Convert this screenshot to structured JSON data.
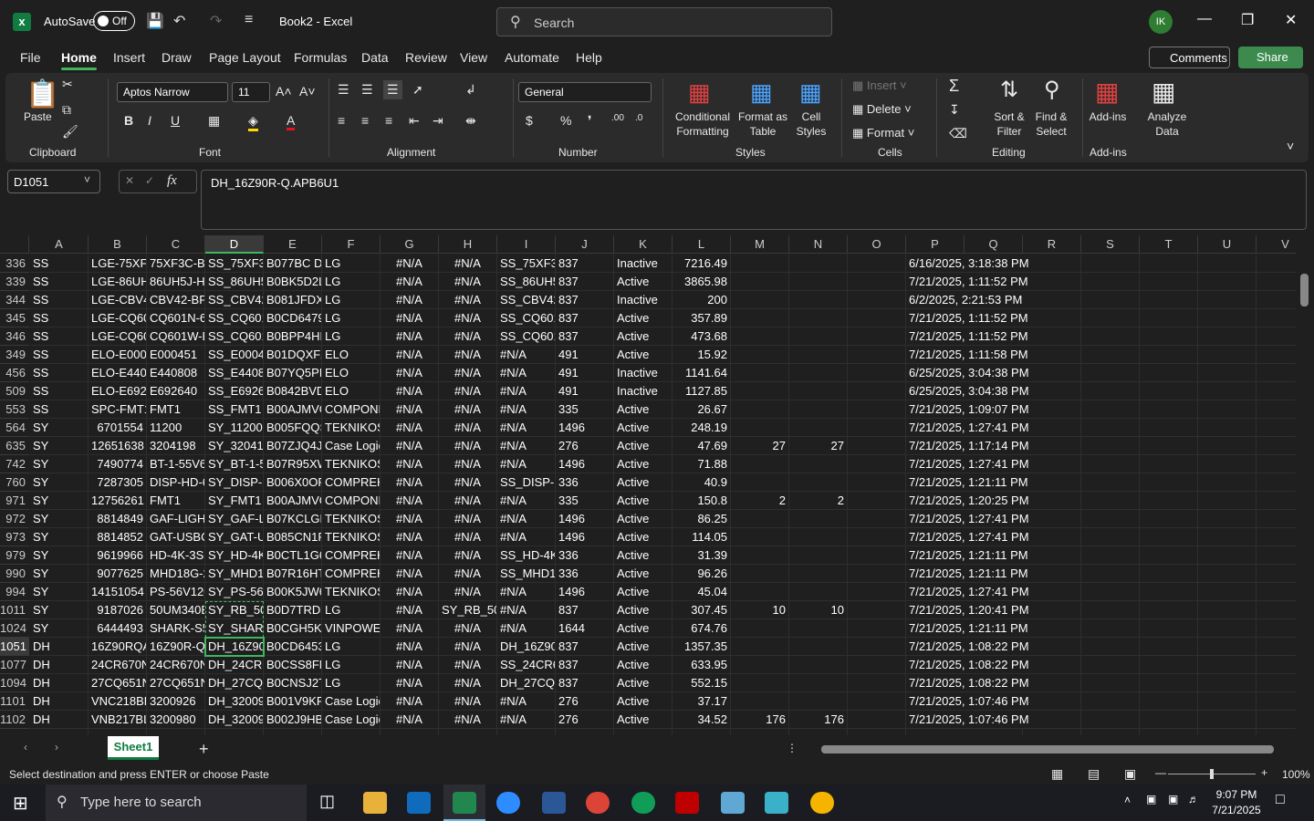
{
  "titlebar": {
    "autosave_label": "AutoSave",
    "autosave_state": "Off",
    "doc_title": "Book2  -  Excel",
    "search_placeholder": "Search",
    "avatar_initials": "IK"
  },
  "menu": {
    "tabs": [
      "File",
      "Home",
      "Insert",
      "Draw",
      "Page Layout",
      "Formulas",
      "Data",
      "Review",
      "View",
      "Automate",
      "Help"
    ],
    "active": "Home",
    "comments_label": "Comments",
    "share_label": "Share"
  },
  "ribbon": {
    "clipboard": {
      "paste": "Paste",
      "group": "Clipboard"
    },
    "font": {
      "name": "Aptos Narrow",
      "size": "11",
      "group": "Font"
    },
    "alignment": {
      "group": "Alignment"
    },
    "number": {
      "format": "General",
      "group": "Number"
    },
    "styles": {
      "conditional": [
        "Conditional",
        "Formatting"
      ],
      "format_table": [
        "Format as",
        "Table"
      ],
      "cell_styles": [
        "Cell",
        "Styles"
      ],
      "group": "Styles"
    },
    "cells": {
      "insert": "Insert",
      "delete": "Delete",
      "format": "Format",
      "group": "Cells"
    },
    "editing": {
      "sort": [
        "Sort &",
        "Filter"
      ],
      "find": [
        "Find &",
        "Select"
      ],
      "group": "Editing"
    },
    "addins": {
      "addins": "Add-ins",
      "analyze": [
        "Analyze",
        "Data"
      ],
      "group": "Add-ins"
    }
  },
  "formula_bar": {
    "name_box": "D1051",
    "formula": "DH_16Z90R-Q.APB6U1"
  },
  "grid": {
    "columns": [
      "A",
      "B",
      "C",
      "D",
      "E",
      "F",
      "G",
      "H",
      "I",
      "J",
      "K",
      "L",
      "M",
      "N",
      "O",
      "P",
      "Q",
      "R",
      "S",
      "T",
      "U",
      "V"
    ],
    "selected_column": "D",
    "selected_row": "1051",
    "rows": [
      {
        "r": "336",
        "A": "SS",
        "B": "LGE-75XF3",
        "C": "75XF3C-B",
        "D": "SS_75XF3C",
        "E": "B077BC DG",
        "F": "LG",
        "G": "#N/A",
        "H": "#N/A",
        "I": "SS_75XF3C",
        "J": "837",
        "K": "Inactive",
        "L": "7216.49",
        "M": "",
        "N": "",
        "P": "6/16/2025, 3:18:38 PM"
      },
      {
        "r": "339",
        "A": "SS",
        "B": "LGE-86UH5",
        "C": "86UH5J-H",
        "D": "SS_86UH5.",
        "E": "B0BK5D2L",
        "F": "LG",
        "G": "#N/A",
        "H": "#N/A",
        "I": "SS_86UH5.",
        "J": "837",
        "K": "Active",
        "L": "3865.98",
        "M": "",
        "N": "",
        "P": "7/21/2025, 1:11:52 PM"
      },
      {
        "r": "344",
        "A": "SS",
        "B": "LGE-CBV42",
        "C": "CBV42-BP",
        "D": "SS_CBV42-",
        "E": "B081JFDX",
        "F": "LG",
        "G": "#N/A",
        "H": "#N/A",
        "I": "SS_CBV42-",
        "J": "837",
        "K": "Inactive",
        "L": "200",
        "M": "",
        "N": "",
        "P": "6/2/2025, 2:21:53 PM"
      },
      {
        "r": "345",
        "A": "SS",
        "B": "LGE-CQ60",
        "C": "CQ601N-6",
        "D": "SS_CQ601",
        "E": "B0CD6479",
        "F": "LG",
        "G": "#N/A",
        "H": "#N/A",
        "I": "SS_CQ601",
        "J": "837",
        "K": "Active",
        "L": "357.89",
        "M": "",
        "N": "",
        "P": "7/21/2025, 1:11:52 PM"
      },
      {
        "r": "346",
        "A": "SS",
        "B": "LGE-CQ60",
        "C": "CQ601W-E",
        "D": "SS_CQ601",
        "E": "B0BPP4HL",
        "F": "LG",
        "G": "#N/A",
        "H": "#N/A",
        "I": "SS_CQ601",
        "J": "837",
        "K": "Active",
        "L": "473.68",
        "M": "",
        "N": "",
        "P": "7/21/2025, 1:11:52 PM"
      },
      {
        "r": "349",
        "A": "SS",
        "B": "ELO-E0004",
        "C": "E000451",
        "D": "SS_E00045",
        "E": "B01DQXFZ",
        "F": "ELO",
        "G": "#N/A",
        "H": "#N/A",
        "I": "#N/A",
        "J": "491",
        "K": "Active",
        "L": "15.92",
        "M": "",
        "N": "",
        "P": "7/21/2025, 1:11:58 PM"
      },
      {
        "r": "456",
        "A": "SS",
        "B": "ELO-E4408",
        "C": "E440808",
        "D": "SS_E44080",
        "E": "B07YQ5PR",
        "F": "ELO",
        "G": "#N/A",
        "H": "#N/A",
        "I": "#N/A",
        "J": "491",
        "K": "Inactive",
        "L": "1141.64",
        "M": "",
        "N": "",
        "P": "6/25/2025, 3:04:38 PM"
      },
      {
        "r": "509",
        "A": "SS",
        "B": "ELO-E6926",
        "C": "E692640",
        "D": "SS_E69264",
        "E": "B0842BVD",
        "F": "ELO",
        "G": "#N/A",
        "H": "#N/A",
        "I": "#N/A",
        "J": "491",
        "K": "Inactive",
        "L": "1127.85",
        "M": "",
        "N": "",
        "P": "6/25/2025, 3:04:38 PM"
      },
      {
        "r": "553",
        "A": "SS",
        "B": "SPC-FMT1",
        "C": "FMT1",
        "D": "SS_FMT1",
        "E": "B00AJMVG",
        "F": "COMPONE",
        "G": "#N/A",
        "H": "#N/A",
        "I": "#N/A",
        "J": "335",
        "K": "Active",
        "L": "26.67",
        "M": "",
        "N": "",
        "P": "7/21/2025, 1:09:07 PM"
      },
      {
        "r": "564",
        "A": "SY",
        "B": "6701554",
        "C": "11200",
        "D": "SY_11200",
        "E": "B005FQQS",
        "F": "TEKNIKOS",
        "G": "#N/A",
        "H": "#N/A",
        "I": "#N/A",
        "J": "1496",
        "K": "Active",
        "L": "248.19",
        "M": "",
        "N": "",
        "P": "7/21/2025, 1:27:41 PM"
      },
      {
        "r": "635",
        "A": "SY",
        "B": "12651638",
        "C": "3204198",
        "D": "SY_320419",
        "E": "B07ZJQ4J6",
        "F": "Case Logic",
        "G": "#N/A",
        "H": "#N/A",
        "I": "#N/A",
        "J": "276",
        "K": "Active",
        "L": "47.69",
        "M": "27",
        "N": "27",
        "P": "7/21/2025, 1:17:14 PM"
      },
      {
        "r": "742",
        "A": "SY",
        "B": "7490774",
        "C": "BT-1-55V6",
        "D": "SY_BT-1-5",
        "E": "B07R95XW",
        "F": "TEKNIKOS",
        "G": "#N/A",
        "H": "#N/A",
        "I": "#N/A",
        "J": "1496",
        "K": "Active",
        "L": "71.88",
        "M": "",
        "N": "",
        "P": "7/21/2025, 1:27:41 PM"
      },
      {
        "r": "760",
        "A": "SY",
        "B": "7287305",
        "C": "DISP-HD-6",
        "D": "SY_DISP-H",
        "E": "B006X0OF",
        "F": "COMPREH",
        "G": "#N/A",
        "H": "#N/A",
        "I": "SS_DISP-H",
        "J": "336",
        "K": "Active",
        "L": "40.9",
        "M": "",
        "N": "",
        "P": "7/21/2025, 1:21:11 PM"
      },
      {
        "r": "971",
        "A": "SY",
        "B": "12756261",
        "C": "FMT1",
        "D": "SY_FMT1",
        "E": "B00AJMVG",
        "F": "COMPONE",
        "G": "#N/A",
        "H": "#N/A",
        "I": "#N/A",
        "J": "335",
        "K": "Active",
        "L": "150.8",
        "M": "2",
        "N": "2",
        "P": "7/21/2025, 1:20:25 PM"
      },
      {
        "r": "972",
        "A": "SY",
        "B": "8814849",
        "C": "GAF-LIGH1",
        "D": "SY_GAF-LI",
        "E": "B07KCLGB",
        "F": "TEKNIKOS",
        "G": "#N/A",
        "H": "#N/A",
        "I": "#N/A",
        "J": "1496",
        "K": "Active",
        "L": "86.25",
        "M": "",
        "N": "",
        "P": "7/21/2025, 1:27:41 PM"
      },
      {
        "r": "973",
        "A": "SY",
        "B": "8814852",
        "C": "GAT-USBC",
        "D": "SY_GAT-US",
        "E": "B085CN1R",
        "F": "TEKNIKOS",
        "G": "#N/A",
        "H": "#N/A",
        "I": "#N/A",
        "J": "1496",
        "K": "Active",
        "L": "114.05",
        "M": "",
        "N": "",
        "P": "7/21/2025, 1:27:41 PM"
      },
      {
        "r": "979",
        "A": "SY",
        "B": "9619966",
        "C": "HD-4K-3SI",
        "D": "SY_HD-4K-",
        "E": "B0CTL1G6",
        "F": "COMPREH",
        "G": "#N/A",
        "H": "#N/A",
        "I": "SS_HD-4K-",
        "J": "336",
        "K": "Active",
        "L": "31.39",
        "M": "",
        "N": "",
        "P": "7/21/2025, 1:21:11 PM"
      },
      {
        "r": "990",
        "A": "SY",
        "B": "9077625",
        "C": "MHD18G-2",
        "D": "SY_MHD18",
        "E": "B07R16HT",
        "F": "COMPREH",
        "G": "#N/A",
        "H": "#N/A",
        "I": "SS_MHD18",
        "J": "336",
        "K": "Active",
        "L": "96.26",
        "M": "",
        "N": "",
        "P": "7/21/2025, 1:21:11 PM"
      },
      {
        "r": "994",
        "A": "SY",
        "B": "14151054",
        "C": "PS-56V120",
        "D": "SY_PS-56V",
        "E": "B00K5JW6",
        "F": "TEKNIKOS",
        "G": "#N/A",
        "H": "#N/A",
        "I": "#N/A",
        "J": "1496",
        "K": "Active",
        "L": "45.04",
        "M": "",
        "N": "",
        "P": "7/21/2025, 1:27:41 PM"
      },
      {
        "r": "1011",
        "A": "SY",
        "B": "9187026",
        "C": "50UM340E",
        "D": "SY_RB_50U",
        "E": "B0D7TRD3",
        "F": "LG",
        "G": "#N/A",
        "H": "SY_RB_50U",
        "I": "#N/A",
        "J": "837",
        "K": "Active",
        "L": "307.45",
        "M": "10",
        "N": "10",
        "P": "7/21/2025, 1:20:41 PM"
      },
      {
        "r": "1024",
        "A": "SY",
        "B": "6444493",
        "C": "SHARK-S5",
        "D": "SY_SHARK",
        "E": "B0CGH5KL",
        "F": "VINPOWEI",
        "G": "#N/A",
        "H": "#N/A",
        "I": "#N/A",
        "J": "1644",
        "K": "Active",
        "L": "674.76",
        "M": "",
        "N": "",
        "P": "7/21/2025, 1:21:11 PM"
      },
      {
        "r": "1051",
        "A": "DH",
        "B": "16Z90RQA",
        "C": "16Z90R-Q.",
        "D": "DH_16Z90",
        "E": "B0CD6453",
        "F": "LG",
        "G": "#N/A",
        "H": "#N/A",
        "I": "DH_16Z90I",
        "J": "837",
        "K": "Active",
        "L": "1357.35",
        "M": "",
        "N": "",
        "P": "7/21/2025, 1:08:22 PM"
      },
      {
        "r": "1077",
        "A": "DH",
        "B": "24CR670N",
        "C": "24CR670N",
        "D": "DH_24CR6",
        "E": "B0CSS8FM",
        "F": "LG",
        "G": "#N/A",
        "H": "#N/A",
        "I": "SS_24CR67",
        "J": "837",
        "K": "Active",
        "L": "633.95",
        "M": "",
        "N": "",
        "P": "7/21/2025, 1:08:22 PM"
      },
      {
        "r": "1094",
        "A": "DH",
        "B": "27CQ651N",
        "C": "27CQ651N",
        "D": "DH_27CQ6",
        "E": "B0CNSJ2T",
        "F": "LG",
        "G": "#N/A",
        "H": "#N/A",
        "I": "DH_27CQ6",
        "J": "837",
        "K": "Active",
        "L": "552.15",
        "M": "",
        "N": "",
        "P": "7/21/2025, 1:08:22 PM"
      },
      {
        "r": "1101",
        "A": "DH",
        "B": "VNC218BL",
        "C": "3200926",
        "D": "DH_32009:",
        "E": "B001V9KF.",
        "F": "Case Logic",
        "G": "#N/A",
        "H": "#N/A",
        "I": "#N/A",
        "J": "276",
        "K": "Active",
        "L": "37.17",
        "M": "",
        "N": "",
        "P": "7/21/2025, 1:07:46 PM"
      },
      {
        "r": "1102",
        "A": "DH",
        "B": "VNB217BL",
        "C": "3200980",
        "D": "DH_32009I",
        "E": "B002J9HB",
        "F": "Case Logic",
        "G": "#N/A",
        "H": "#N/A",
        "I": "#N/A",
        "J": "276",
        "K": "Active",
        "L": "34.52",
        "M": "176",
        "N": "176",
        "P": "7/21/2025, 1:07:46 PM"
      }
    ]
  },
  "sheets": {
    "tabs": [
      "Sheet1"
    ],
    "add": "+"
  },
  "status": {
    "message": "Select destination and press ENTER or choose Paste",
    "zoom": "100%"
  },
  "taskbar": {
    "search_placeholder": "Type here to search",
    "time": "9:07 PM",
    "date": "7/21/2025"
  },
  "colors": {
    "accent": "#3fb760",
    "excel_green": "#107c41",
    "background": "#1f1f1f"
  }
}
